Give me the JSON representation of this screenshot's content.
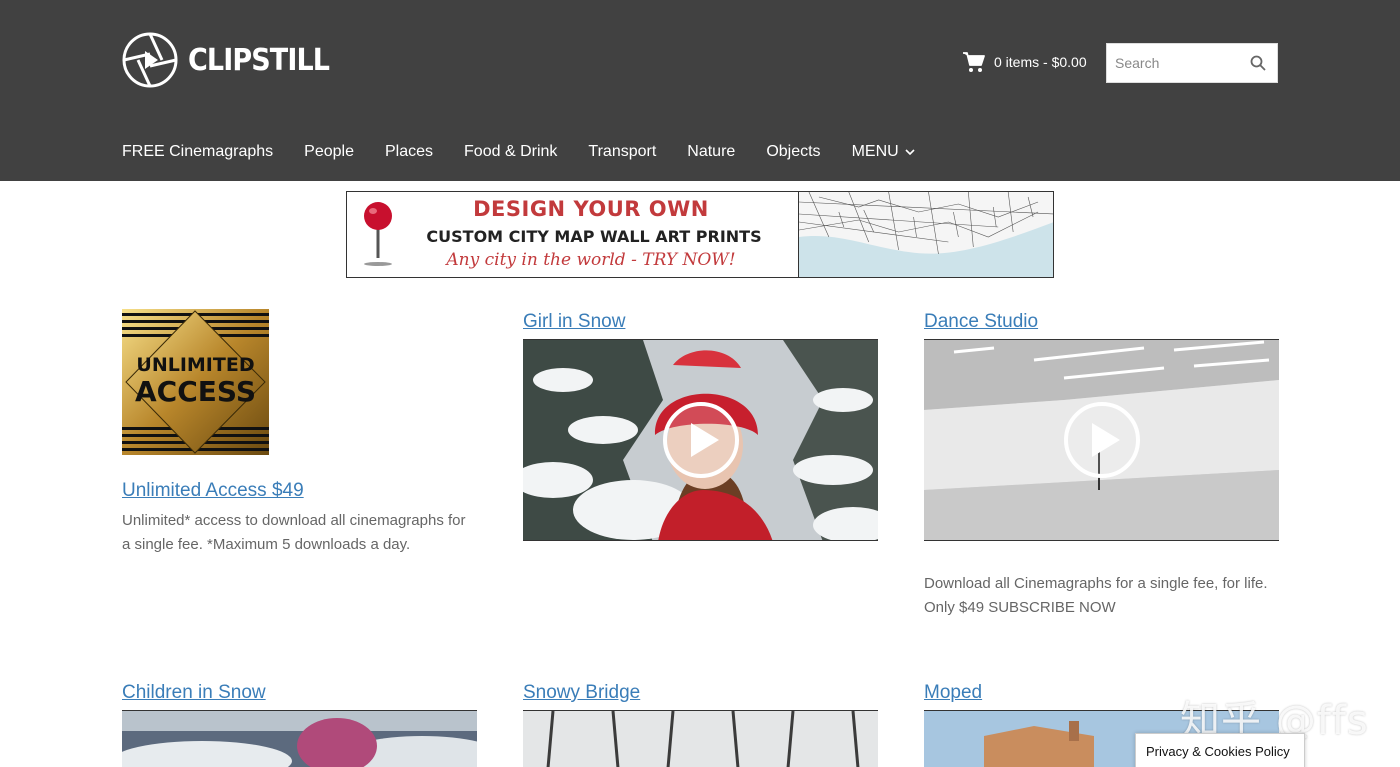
{
  "header": {
    "logo_text": "CLIPSTILL",
    "cart_text": "0 items - $0.00",
    "search_placeholder": "Search",
    "bg_color": "#414141"
  },
  "nav": {
    "items": [
      "FREE Cinemagraphs",
      "People",
      "Places",
      "Food & Drink",
      "Transport",
      "Nature",
      "Objects"
    ],
    "menu_label": "MENU"
  },
  "banner": {
    "line1": "DESIGN YOUR OWN",
    "line2": "CUSTOM CITY MAP WALL ART PRINTS",
    "line3": "Any city in the world - TRY NOW!"
  },
  "products": {
    "unlimited": {
      "badge_line1": "UNLIMITED",
      "badge_line2": "ACCESS",
      "title": "Unlimited Access $49",
      "desc": "Unlimited* access to download all cinemagraphs for a single fee. *Maximum 5 downloads a day."
    },
    "girl_in_snow": {
      "title": "Girl in Snow"
    },
    "dance_studio": {
      "title": "Dance Studio",
      "desc": "Download all Cinemagraphs for a single fee, for life. Only $49 SUBSCRIBE NOW"
    },
    "children_in_snow": {
      "title": "Children in Snow"
    },
    "snowy_bridge": {
      "title": "Snowy Bridge"
    },
    "moped": {
      "title": "Moped"
    }
  },
  "watermark": "知乎 @ffs",
  "privacy_label": "Privacy & Cookies Policy",
  "colors": {
    "link": "#3a7db8",
    "accent_red": "#c23a3c"
  }
}
